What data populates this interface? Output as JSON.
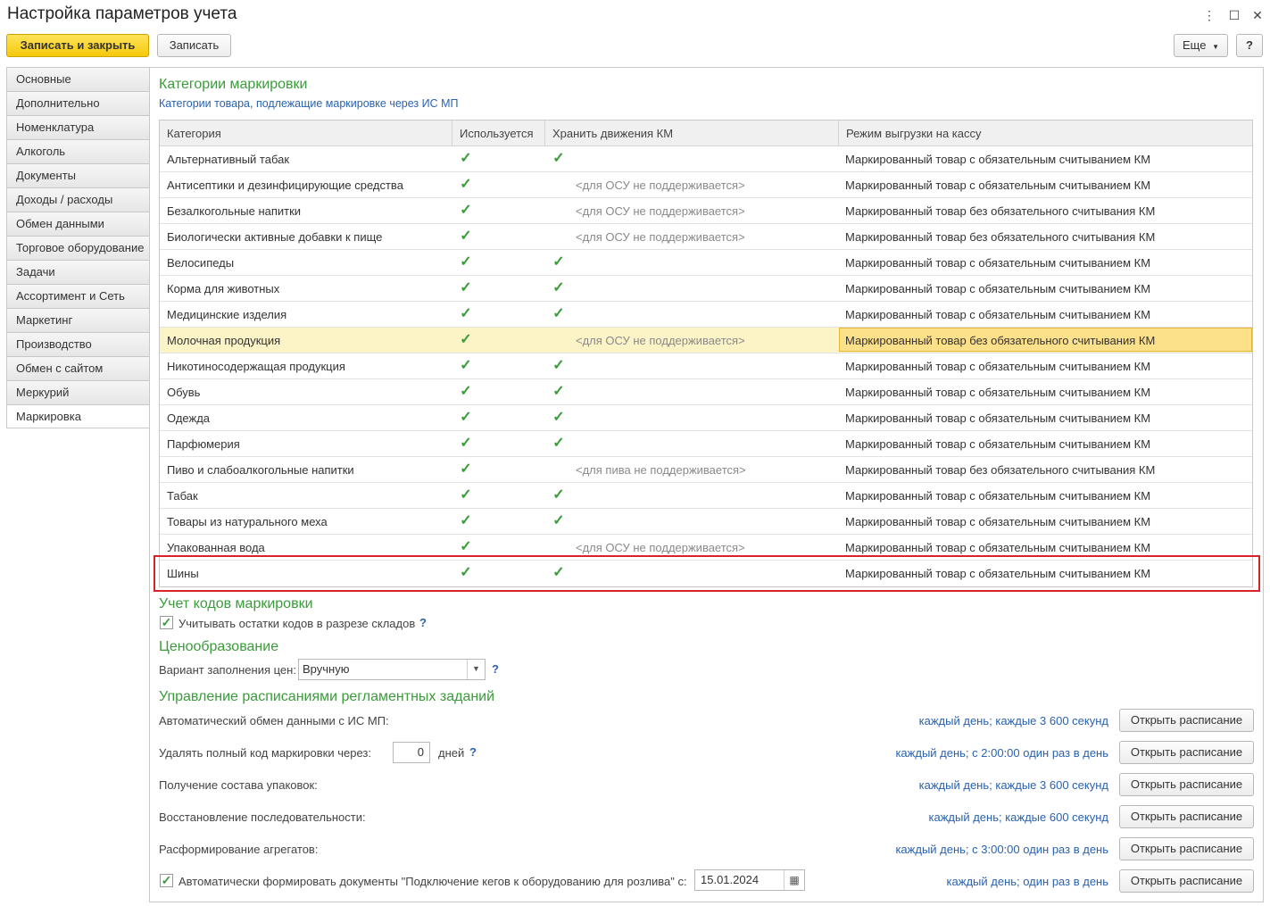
{
  "window": {
    "title": "Настройка параметров учета"
  },
  "toolbar": {
    "save_close_label": "Записать и закрыть",
    "save_label": "Записать",
    "more_label": "Еще",
    "help_label": "?"
  },
  "nav": {
    "items": [
      {
        "label": "Основные"
      },
      {
        "label": "Дополнительно"
      },
      {
        "label": "Номенклатура"
      },
      {
        "label": "Алкоголь"
      },
      {
        "label": "Документы"
      },
      {
        "label": "Доходы / расходы"
      },
      {
        "label": "Обмен данными"
      },
      {
        "label": "Торговое оборудование"
      },
      {
        "label": "Задачи"
      },
      {
        "label": "Ассортимент и Сеть"
      },
      {
        "label": "Маркетинг"
      },
      {
        "label": "Производство"
      },
      {
        "label": "Обмен с сайтом"
      },
      {
        "label": "Меркурий"
      },
      {
        "label": "Маркировка"
      }
    ],
    "active": "Маркировка"
  },
  "marking": {
    "title": "Категории маркировки",
    "subtitle": "Категории товара, подлежащие маркировке через ИС МП",
    "columns": {
      "category": "Категория",
      "used": "Используется",
      "store": "Хранить движения КМ",
      "mode": "Режим выгрузки на кассу"
    },
    "rows": [
      {
        "category": "Альтернативный табак",
        "used": true,
        "store": true,
        "note": "",
        "mode": "Маркированный товар с обязательным считыванием КМ"
      },
      {
        "category": "Антисептики и дезинфицирующие средства",
        "used": true,
        "store": false,
        "note": "<для ОСУ не поддерживается>",
        "mode": "Маркированный товар с обязательным считыванием КМ"
      },
      {
        "category": "Безалкогольные напитки",
        "used": true,
        "store": false,
        "note": "<для ОСУ не поддерживается>",
        "mode": "Маркированный товар без обязательного считывания КМ"
      },
      {
        "category": "Биологически активные добавки к пище",
        "used": true,
        "store": false,
        "note": "<для ОСУ не поддерживается>",
        "mode": "Маркированный товар без обязательного считывания КМ"
      },
      {
        "category": "Велосипеды",
        "used": true,
        "store": true,
        "note": "",
        "mode": "Маркированный товар с обязательным считыванием КМ"
      },
      {
        "category": "Корма для животных",
        "used": true,
        "store": true,
        "note": "",
        "mode": "Маркированный товар с обязательным считыванием КМ"
      },
      {
        "category": "Медицинские изделия",
        "used": true,
        "store": true,
        "note": "",
        "mode": "Маркированный товар с обязательным считыванием КМ"
      },
      {
        "category": "Молочная продукция",
        "used": true,
        "store": false,
        "note": "<для ОСУ не поддерживается>",
        "mode": "Маркированный товар без обязательного считывания КМ",
        "selected": true
      },
      {
        "category": "Никотиносодержащая продукция",
        "used": true,
        "store": true,
        "note": "",
        "mode": "Маркированный товар с обязательным считыванием КМ"
      },
      {
        "category": "Обувь",
        "used": true,
        "store": true,
        "note": "",
        "mode": "Маркированный товар с обязательным считыванием КМ"
      },
      {
        "category": "Одежда",
        "used": true,
        "store": true,
        "note": "",
        "mode": "Маркированный товар с обязательным считыванием КМ"
      },
      {
        "category": "Парфюмерия",
        "used": true,
        "store": true,
        "note": "",
        "mode": "Маркированный товар с обязательным считыванием КМ"
      },
      {
        "category": "Пиво и слабоалкогольные напитки",
        "used": true,
        "store": false,
        "note": "<для пива не поддерживается>",
        "mode": "Маркированный товар без обязательного считывания КМ"
      },
      {
        "category": "Табак",
        "used": true,
        "store": true,
        "note": "",
        "mode": "Маркированный товар с обязательным считыванием КМ"
      },
      {
        "category": "Товары из натурального меха",
        "used": true,
        "store": true,
        "note": "",
        "mode": "Маркированный товар с обязательным считыванием КМ"
      },
      {
        "category": "Упакованная вода",
        "used": true,
        "store": false,
        "note": "<для ОСУ не поддерживается>",
        "mode": "Маркированный товар с обязательным считыванием КМ"
      },
      {
        "category": "Шины",
        "used": true,
        "store": true,
        "note": "",
        "mode": "Маркированный товар с обязательным считыванием КМ",
        "highlighted": true
      }
    ]
  },
  "codes": {
    "title": "Учет кодов маркировки",
    "balance_label": "Учитывать остатки кодов в разрезе складов",
    "balance_checked": true,
    "help": "?"
  },
  "pricing": {
    "title": "Ценообразование",
    "fill_label": "Вариант заполнения цен:",
    "fill_value": "Вручную",
    "help": "?"
  },
  "schedules": {
    "title": "Управление расписаниями регламентных заданий",
    "button_label": "Открыть расписание",
    "items": [
      {
        "label": "Автоматический обмен данными с ИС МП:",
        "schedule": "каждый день; каждые 3 600 секунд"
      },
      {
        "label": "Удалять полный код маркировки через:",
        "value": "0",
        "unit": "дней",
        "help": "?",
        "schedule": "каждый день; с 2:00:00 один раз в день"
      },
      {
        "label": "Получение состава упаковок:",
        "schedule": "каждый день; каждые 3 600 секунд"
      },
      {
        "label": "Восстановление последовательности:",
        "schedule": "каждый день; каждые 600 секунд"
      },
      {
        "label": "Расформирование агрегатов:",
        "schedule": "каждый день; с 3:00:00 один раз в день"
      },
      {
        "label": "Автоматически формировать документы \"Подключение кегов к оборудованию для розлива\" с:",
        "checked": true,
        "date": "15.01.2024",
        "schedule": "каждый день; один раз в день"
      }
    ]
  },
  "colors": {
    "accent_green": "#3a9c3a",
    "link_blue": "#2a62b0",
    "primary_yellow": "#f5c90a",
    "highlight_red": "#d8232a",
    "selected_row": "#fcf3c7"
  }
}
